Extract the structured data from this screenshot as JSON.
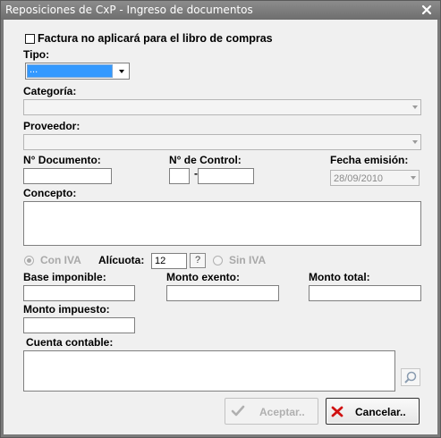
{
  "window": {
    "title": "Reposiciones de CxP - Ingreso de documentos"
  },
  "form": {
    "checkbox_label": "Factura no aplicará para el libro de compras",
    "tipo_label": "Tipo:",
    "tipo_value": "...",
    "categoria_label": "Categoría:",
    "proveedor_label": "Proveedor:",
    "documento_label": "N° Documento:",
    "control_label": "N° de Control:",
    "control_separator": "-",
    "fecha_label": "Fecha emisión:",
    "fecha_value": "28/09/2010",
    "concepto_label": "Concepto:",
    "con_iva_label": "Con IVA",
    "alicuota_label": "Alícuota:",
    "alicuota_value": "12",
    "help_glyph": "?",
    "sin_iva_label": "Sin IVA",
    "base_label": "Base imponible:",
    "exento_label": "Monto exento:",
    "total_label": "Monto total:",
    "impuesto_label": "Monto impuesto:",
    "cuenta_label": "Cuenta contable:"
  },
  "buttons": {
    "accept_label": "Aceptar..",
    "cancel_label": "Cancelar.."
  },
  "icons": {
    "close": "close-icon",
    "accept": "checkmark-icon",
    "cancel": "x-icon",
    "search": "magnifier-icon"
  },
  "colors": {
    "titlebar": "#7a7a7a",
    "selection": "#3399ff",
    "cancel_x": "#d01010",
    "accept_check": "#b0b0b0"
  }
}
